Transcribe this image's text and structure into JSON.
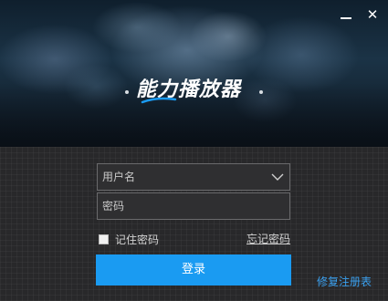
{
  "window": {
    "minimize_icon": "minimize-icon",
    "close_icon": "close-icon",
    "close_glyph": "✕"
  },
  "brand": {
    "name": "能力播放器",
    "accent": "#1a9bf2"
  },
  "login_form": {
    "username": {
      "placeholder": "用户名",
      "value": "",
      "dropdown_icon": "chevron-down-icon"
    },
    "password": {
      "placeholder": "密码",
      "value": ""
    },
    "remember_label": "记住密码",
    "remember_checked": false,
    "forgot_link": "忘记密码",
    "submit_label": "登录"
  },
  "footer": {
    "repair_link": "修复注册表"
  }
}
